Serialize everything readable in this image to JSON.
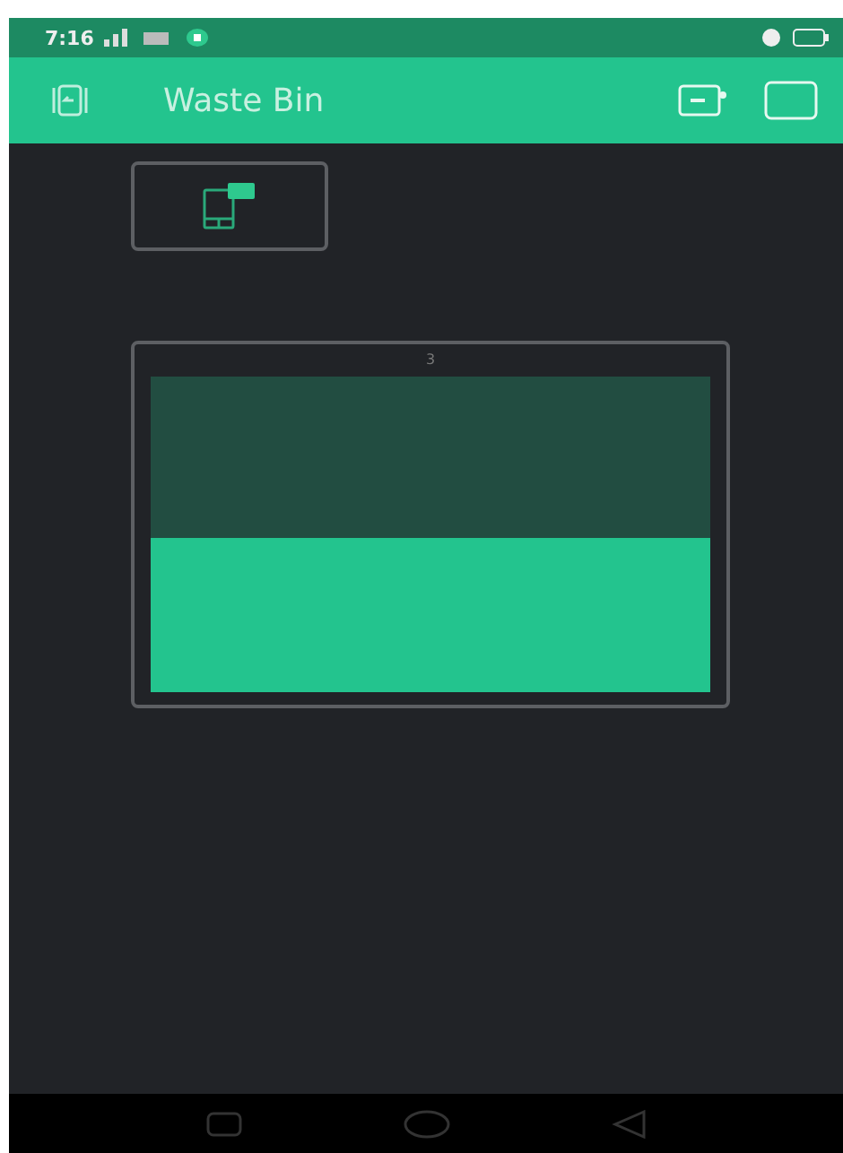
{
  "status_bar": {
    "time": "7:16"
  },
  "app_bar": {
    "title": "Waste Bin"
  },
  "level_widget": {
    "label": "3"
  }
}
